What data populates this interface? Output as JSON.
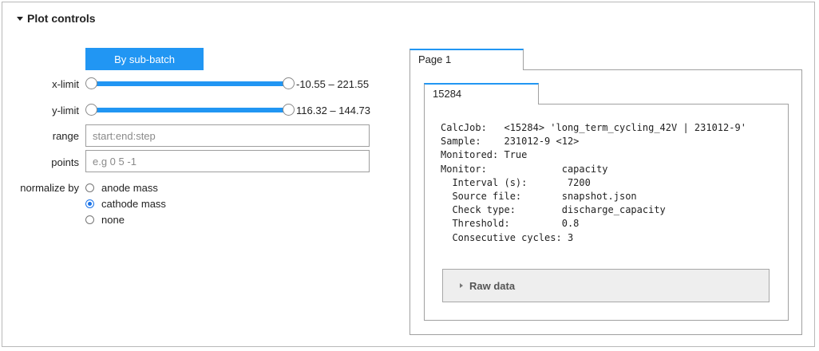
{
  "plot_controls": {
    "title": "Plot controls",
    "group_button": "By sub-batch",
    "x_limit": {
      "label": "x-limit",
      "readout": "-10.55 – 221.55",
      "min": -10.55,
      "max": 221.55
    },
    "y_limit": {
      "label": "y-limit",
      "readout": "116.32 – 144.73",
      "min": 116.32,
      "max": 144.73
    },
    "range": {
      "label": "range",
      "value": "",
      "placeholder": "start:end:step"
    },
    "points": {
      "label": "points",
      "value": "",
      "placeholder": "e.g 0 5 -1"
    },
    "normalize": {
      "label": "normalize by",
      "options": [
        "anode mass",
        "cathode mass",
        "none"
      ],
      "selected": "cathode mass"
    }
  },
  "tabs": {
    "outer": "Page 1",
    "inner": "15284"
  },
  "info": {
    "calcjob_label": "CalcJob:",
    "calcjob_value": "<15284> 'long_term_cycling_42V | 231012-9'",
    "sample_label": "Sample:",
    "sample_value": "231012-9 <12>",
    "monitored_label": "Monitored:",
    "monitored_value": "True",
    "monitor_label": "Monitor:",
    "monitor_value": "capacity",
    "interval_label": "Interval (s):",
    "interval_value": "7200",
    "source_label": "Source file:",
    "source_value": "snapshot.json",
    "check_label": "Check type:",
    "check_value": "discharge_capacity",
    "threshold_label": "Threshold:",
    "threshold_value": "0.8",
    "consecutive_label": "Consecutive cycles:",
    "consecutive_value": "3"
  },
  "raw_data": {
    "label": "Raw data"
  },
  "colors": {
    "accent": "#2196f3",
    "border": "#a0a0a0",
    "panel_bg": "#eeeeee"
  }
}
